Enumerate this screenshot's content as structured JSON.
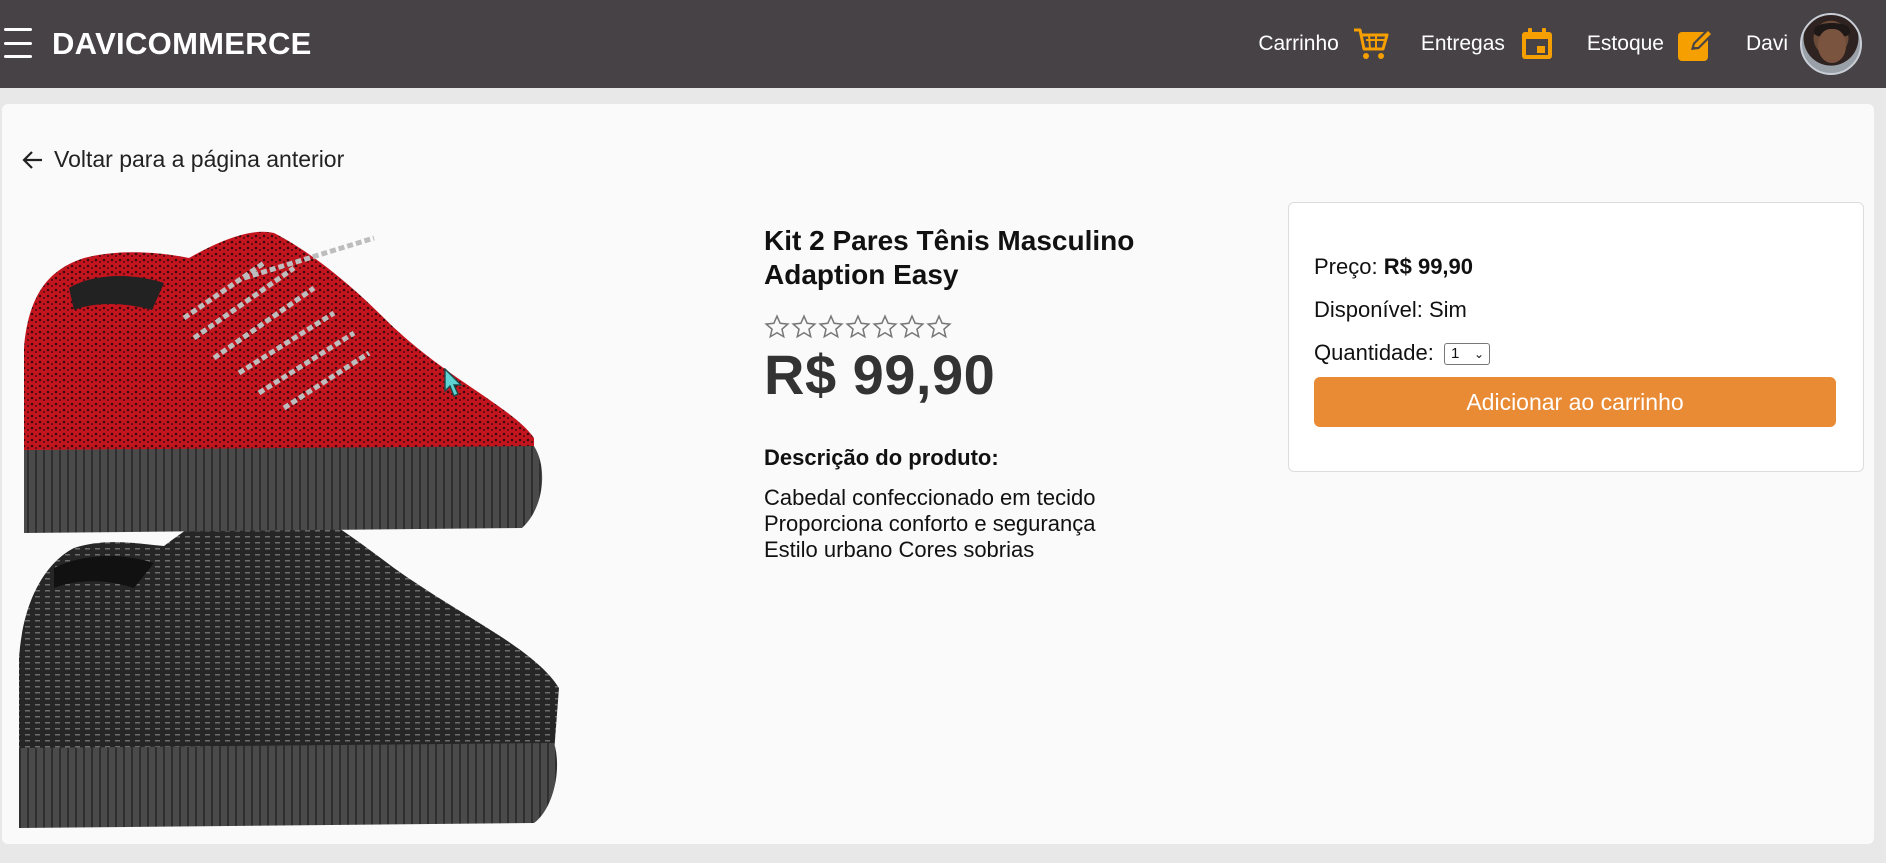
{
  "header": {
    "brand": "DAVICOMMERCE",
    "nav": [
      {
        "label": "Carrinho",
        "icon": "cart-icon"
      },
      {
        "label": "Entregas",
        "icon": "calendar-icon"
      },
      {
        "label": "Estoque",
        "icon": "edit-icon"
      }
    ],
    "user_name": "Davi",
    "accent_color": "#f5a000",
    "bg_color": "#474245"
  },
  "page": {
    "back_link": "Voltar para a página anterior",
    "product": {
      "title": "Kit 2 Pares Tênis Masculino Adaption Easy",
      "rating": 0,
      "rating_max": 7,
      "price": "R$ 99,90",
      "description_title": "Descrição do produto:",
      "description_lines": [
        "Cabedal confeccionado em tecido",
        "Proporciona conforto e segurança",
        "Estilo urbano Cores sobrias"
      ]
    },
    "buybox": {
      "price_label": "Preço:",
      "price_value": "R$ 99,90",
      "available_label": "Disponível:",
      "available_value": "Sim",
      "quantity_label": "Quantidade:",
      "quantity_value": "1",
      "add_button": "Adicionar ao carrinho",
      "button_color": "#e98a35"
    }
  }
}
